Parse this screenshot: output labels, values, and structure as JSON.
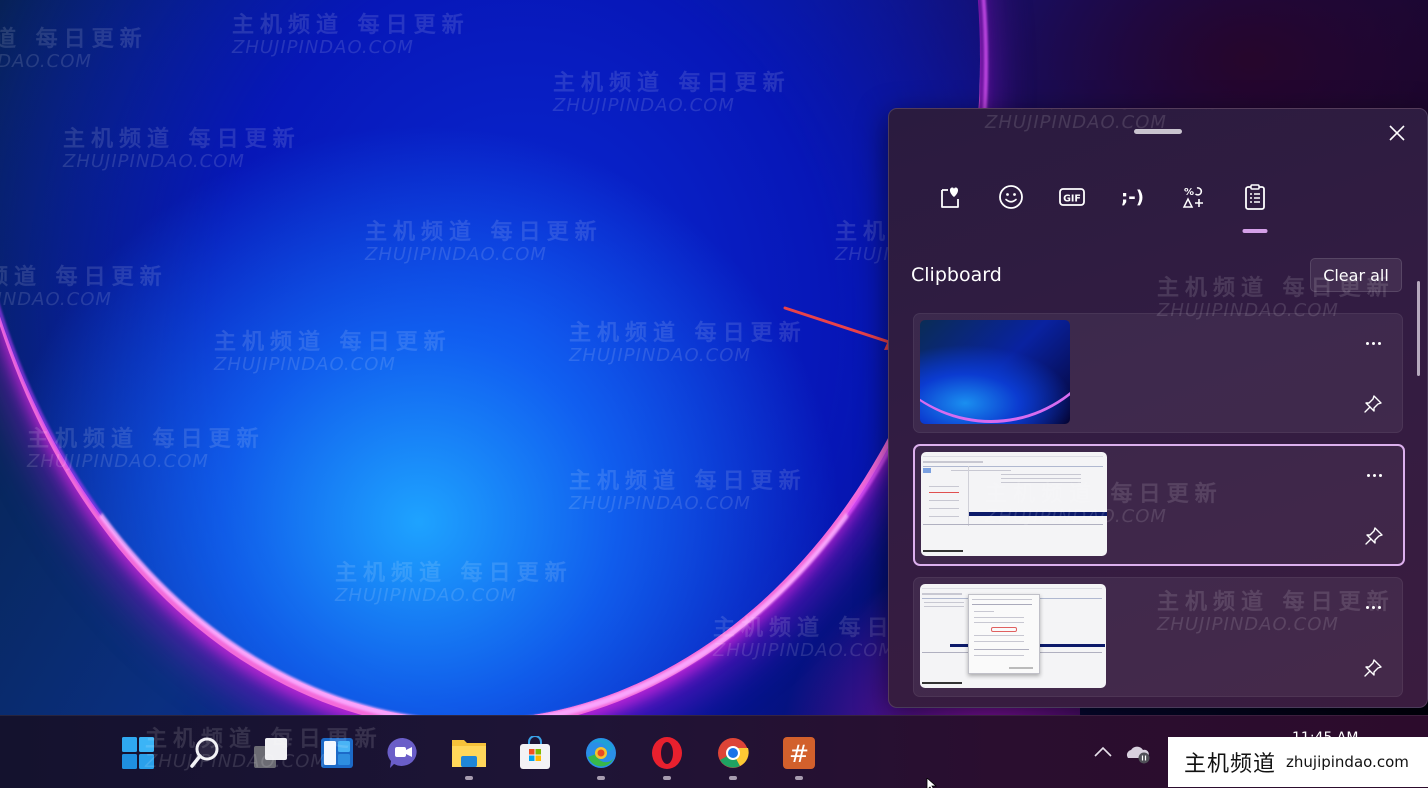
{
  "watermark": {
    "cn": "主机频道 每日更新",
    "en": "ZHUJIPINDAO.COM"
  },
  "clipboard_panel": {
    "tabs": [
      {
        "name": "favorites",
        "icon": "heart-sticker-icon",
        "selected": false
      },
      {
        "name": "emoji",
        "icon": "smiley-icon",
        "selected": false
      },
      {
        "name": "gif",
        "icon": "gif-icon",
        "label": "GIF",
        "selected": false
      },
      {
        "name": "kaomoji",
        "icon": "kaomoji-icon",
        "label": ";-)",
        "selected": false
      },
      {
        "name": "symbols",
        "icon": "symbols-icon",
        "selected": false
      },
      {
        "name": "clipboard",
        "icon": "clipboard-icon",
        "selected": true
      }
    ],
    "title": "Clipboard",
    "clear_all_label": "Clear all",
    "close_label": "Close",
    "accent_color": "#dcb0ee",
    "items": [
      {
        "type": "image",
        "description": "Windows 11 bloom wallpaper",
        "selected": false,
        "pinned": false
      },
      {
        "type": "image",
        "description": "Disk Management screenshot",
        "selected": true,
        "pinned": false
      },
      {
        "type": "image",
        "description": "Disk Management screenshot with properties dialog",
        "selected": false,
        "pinned": false
      }
    ]
  },
  "taskbar": {
    "apps": [
      {
        "name": "start",
        "running": false
      },
      {
        "name": "search",
        "running": false
      },
      {
        "name": "task-view",
        "running": false
      },
      {
        "name": "widgets",
        "running": false
      },
      {
        "name": "teams-chat",
        "running": false
      },
      {
        "name": "file-explorer",
        "running": true
      },
      {
        "name": "microsoft-store",
        "running": false
      },
      {
        "name": "edge",
        "running": true
      },
      {
        "name": "opera",
        "running": true
      },
      {
        "name": "chrome",
        "running": true
      },
      {
        "name": "hash-app",
        "running": true
      }
    ],
    "clock": "11:45 AM"
  },
  "overlay_banner": {
    "cn": "主机频道",
    "en": "zhujipindao.com"
  }
}
